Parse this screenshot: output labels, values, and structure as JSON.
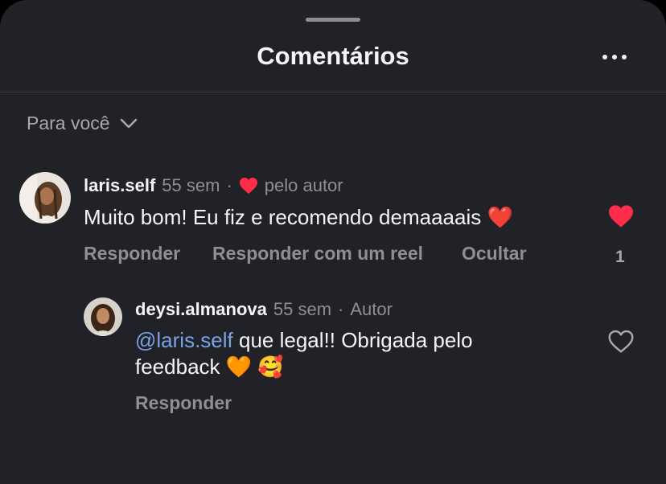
{
  "sheet": {
    "title": "Comentários",
    "sort_label": "Para você"
  },
  "comments": [
    {
      "username": "laris.self",
      "time": "55 sem",
      "separator": "·",
      "liked_by_author_label": "pelo autor",
      "text": "Muito bom! Eu fiz e recomendo demaaaais",
      "emoji": "❤️",
      "liked": true,
      "like_count": "1",
      "actions": {
        "reply": "Responder",
        "reply_with_reel": "Responder com um reel",
        "hide": "Ocultar"
      },
      "replies": [
        {
          "username": "deysi.almanova",
          "time": "55 sem",
          "separator": "·",
          "badge": "Autor",
          "mention": "@laris.self",
          "text_line1": "que legal!! Obrigada pelo",
          "text_line2": "feedback",
          "emoji1": "🧡",
          "emoji2": "🥰",
          "liked": false,
          "actions": {
            "reply": "Responder"
          }
        }
      ]
    }
  ],
  "colors": {
    "sheet_bg": "#212227",
    "primary_text": "#f5f5f7",
    "secondary_text": "#8e8f95",
    "mention": "#7aa3e5",
    "heart_red": "#ff2d49"
  }
}
